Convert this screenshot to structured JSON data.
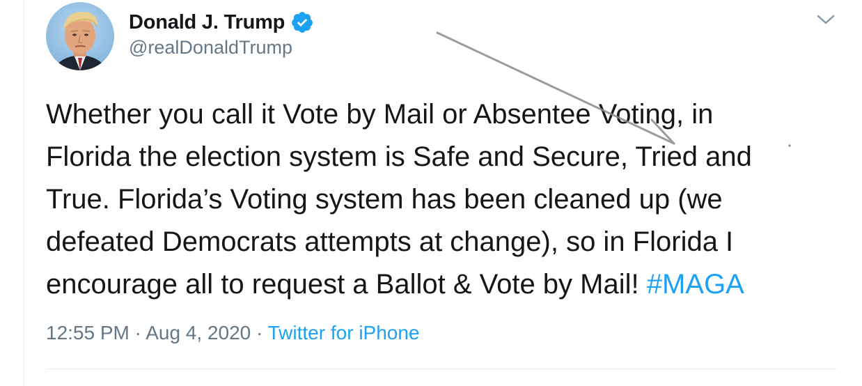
{
  "author": {
    "display_name": "Donald J. Trump",
    "handle": "@realDonaldTrump",
    "verified": true,
    "verified_color": "#1da1f2"
  },
  "tweet": {
    "lines": [
      "Whether you call it Vote by Mail or Absentee Voting, in",
      "Florida the election system is Safe and Secure, Tried and",
      "True. Florida’s Voting system has been cleaned up (we",
      "defeated Democrats attempts at change), so in Florida I",
      "encourage all to request a Ballot & Vote by Mail! "
    ],
    "hashtag": "#MAGA"
  },
  "meta": {
    "time": "12:55 PM",
    "separator": " · ",
    "date": "Aug 4, 2020",
    "source": "Twitter for iPhone"
  },
  "icons": {
    "menu": "chevron-down-icon",
    "verified": "verified-badge-icon"
  },
  "colors": {
    "text": "#14171a",
    "secondary": "#657786",
    "link": "#1da1f2",
    "divider": "#e6ecf0"
  }
}
